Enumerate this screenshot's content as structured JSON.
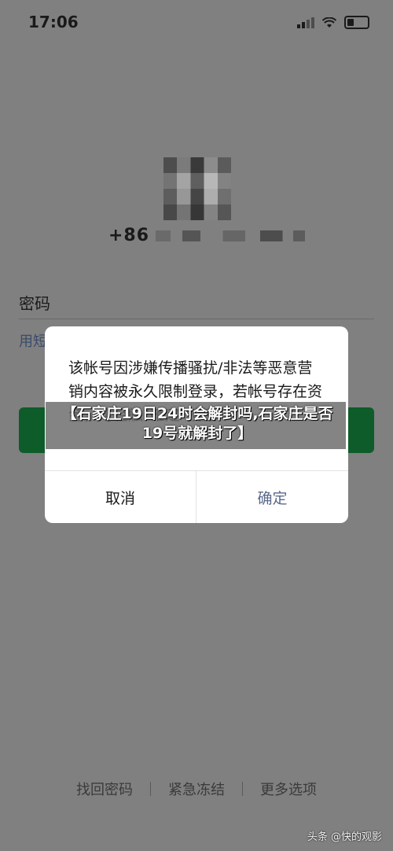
{
  "status_bar": {
    "time": "17:06"
  },
  "account": {
    "phone_prefix": "+86"
  },
  "password": {
    "label": "密码"
  },
  "sms_login": {
    "label": "用短"
  },
  "dialog": {
    "message": "该帐号因涉嫌传播骚扰/非法等恶意营销内容被永久限制登录，若帐号存在资金，可轻触\"確定\"按钮",
    "cancel_label": "取消",
    "confirm_label": "确定"
  },
  "banner": {
    "text": "【石家庄19日24时会解封吗,石家庄是否19号就解封了】"
  },
  "footer": {
    "recover_password": "找回密码",
    "emergency_freeze": "紧急冻结",
    "more_options": "更多选项"
  },
  "watermark": "头条 @快的观影"
}
